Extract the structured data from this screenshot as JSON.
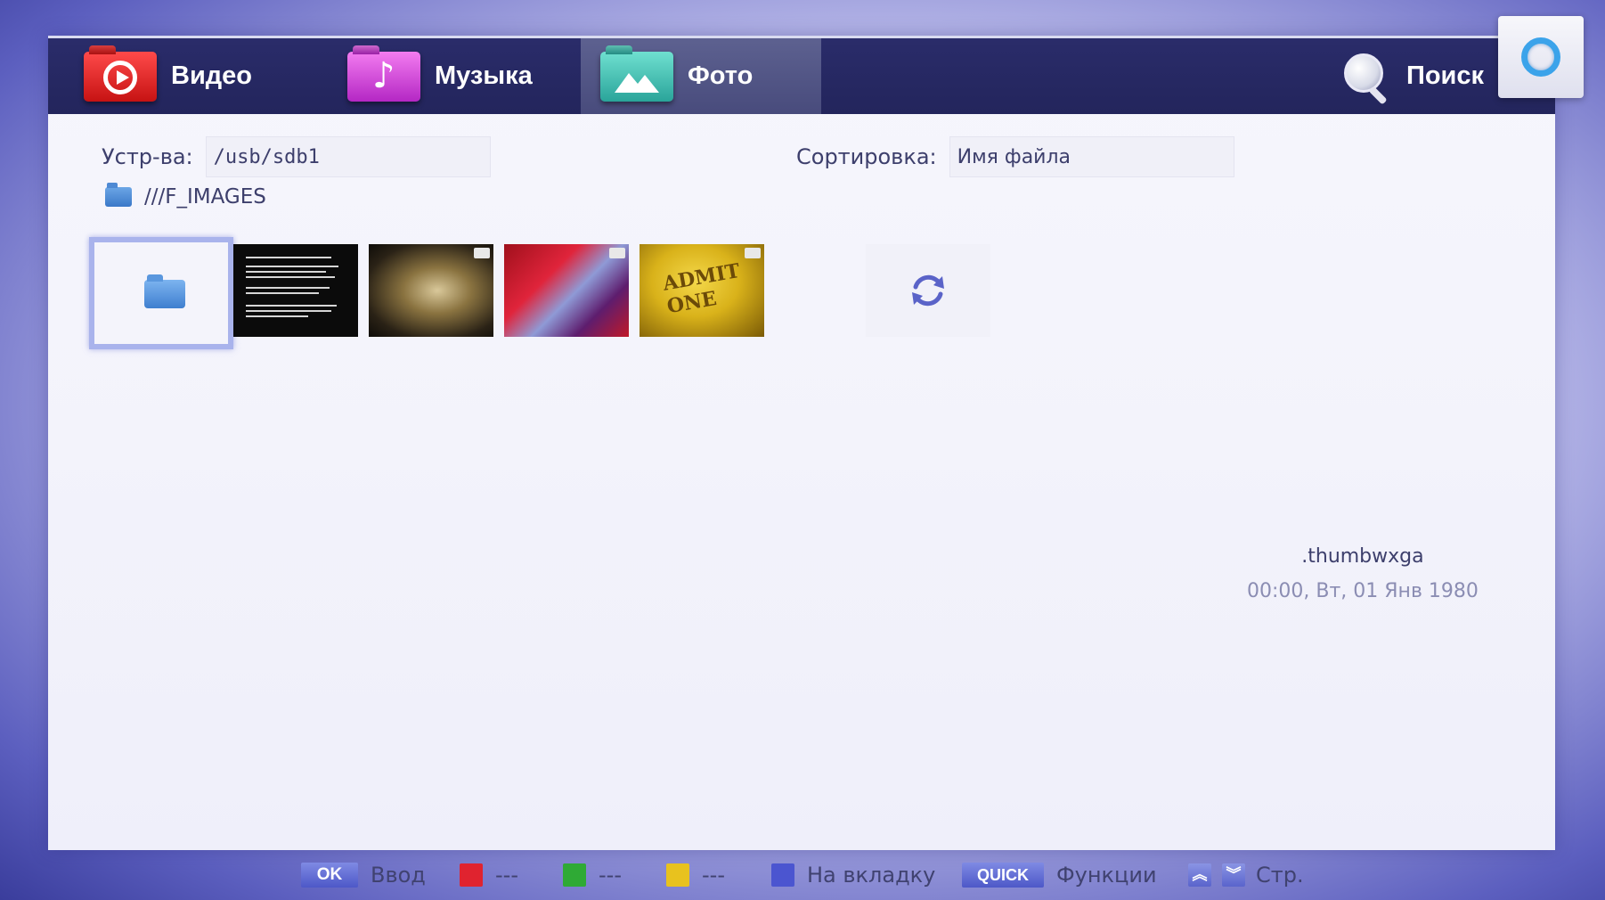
{
  "tabs": [
    {
      "label": "Видео",
      "icon": "video-icon",
      "active": false
    },
    {
      "label": "Музыка",
      "icon": "music-icon",
      "active": false
    },
    {
      "label": "Фото",
      "icon": "photo-icon",
      "active": true
    }
  ],
  "search": {
    "label": "Поиск",
    "icon": "search-icon"
  },
  "corner_button": {
    "icon": "ring-icon"
  },
  "device": {
    "label": "Устр-ва:",
    "value": "/usb/sdb1"
  },
  "sort": {
    "label": "Сортировка:",
    "value": "Имя файла"
  },
  "path": {
    "icon": "folder-icon",
    "text": "///F_IMAGES"
  },
  "thumbnails": [
    {
      "kind": "folder",
      "icon": "folder-icon",
      "selected": true
    },
    {
      "kind": "image",
      "description_icon": "document-image"
    },
    {
      "kind": "image",
      "description_icon": "guitar-image"
    },
    {
      "kind": "image",
      "description_icon": "red-fabric-image"
    },
    {
      "kind": "image",
      "description_icon": "ticket-image",
      "text": "ADMIT ONE"
    },
    {
      "kind": "action",
      "icon": "refresh-icon"
    }
  ],
  "details": {
    "name": ".thumbwxga",
    "date": "00:00, Вт, 01 Янв 1980"
  },
  "legend": {
    "ok_key": "OK",
    "ok_label": "Ввод",
    "red_label": "---",
    "green_label": "---",
    "yellow_label": "---",
    "blue_label": "На вкладку",
    "quick_key": "QUICK",
    "quick_label": "Функции",
    "page_label": "Стр."
  },
  "colors": {
    "red": "#e0232f",
    "green": "#2faa35",
    "yellow": "#e8c21e",
    "blue": "#4b55d0",
    "selection": "#a9b3ec"
  }
}
